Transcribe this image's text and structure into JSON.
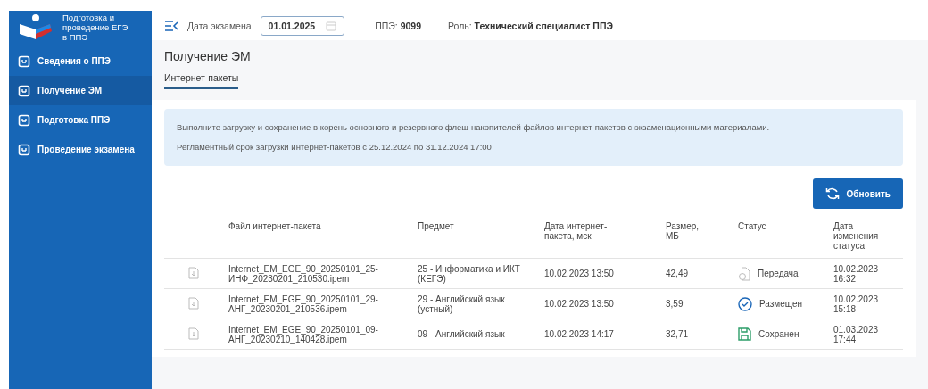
{
  "sidebar": {
    "logo_text": "Подготовка и проведение ЕГЭ в ППЭ",
    "items": [
      {
        "label": "Сведения о ППЭ",
        "selected": false
      },
      {
        "label": "Получение ЭМ",
        "selected": true
      },
      {
        "label": "Подготовка ППЭ",
        "selected": false
      },
      {
        "label": "Проведение экзамена",
        "selected": false
      }
    ]
  },
  "header": {
    "date_label": "Дата экзамена",
    "date_value": "01.01.2025",
    "ppe_label": "ППЭ:",
    "ppe_value": "9099",
    "role_label": "Роль:",
    "role_value": "Технический специалист ППЭ"
  },
  "page_title": "Получение ЭМ",
  "tabs": [
    {
      "label": "Интернет-пакеты",
      "selected": true
    }
  ],
  "info": [
    "Выполните загрузку и сохранение в корень основного и резервного флеш-накопителей файлов интернет-пакетов с экзаменационными материалами.",
    "Регламентный срок загрузки интернет-пакетов с 25.12.2024 по 31.12.2024 17:00"
  ],
  "refresh_button": "Обновить",
  "table": {
    "columns": [
      "Файл интернет-пакета",
      "Предмет",
      "Дата интернет-пакета, мск",
      "Размер, МБ",
      "Статус",
      "Дата изменения статуса"
    ],
    "rows": [
      {
        "file": "Internet_EM_EGE_90_20250101_25-ИНФ_20230201_210530.ipem",
        "subject": "25 - Информатика и ИКТ (КЕГЭ)",
        "date": "10.02.2023 13:50",
        "size": "42,49",
        "status": {
          "kind": "transfer",
          "label": "Передача"
        },
        "changed": "10.02.2023 16:32"
      },
      {
        "file": "Internet_EM_EGE_90_20250101_29-АНГ_20230201_210536.ipem",
        "subject": "29 - Английский язык (устный)",
        "date": "10.02.2023 13:50",
        "size": "3,59",
        "status": {
          "kind": "placed",
          "label": "Размещен"
        },
        "changed": "10.02.2023 15:18"
      },
      {
        "file": "Internet_EM_EGE_90_20250101_09-АНГ_20230210_140428.ipem",
        "subject": "09 - Английский язык",
        "date": "10.02.2023 14:17",
        "size": "32,71",
        "status": {
          "kind": "saved",
          "label": "Сохранен"
        },
        "changed": "01.03.2023 17:44"
      }
    ]
  }
}
